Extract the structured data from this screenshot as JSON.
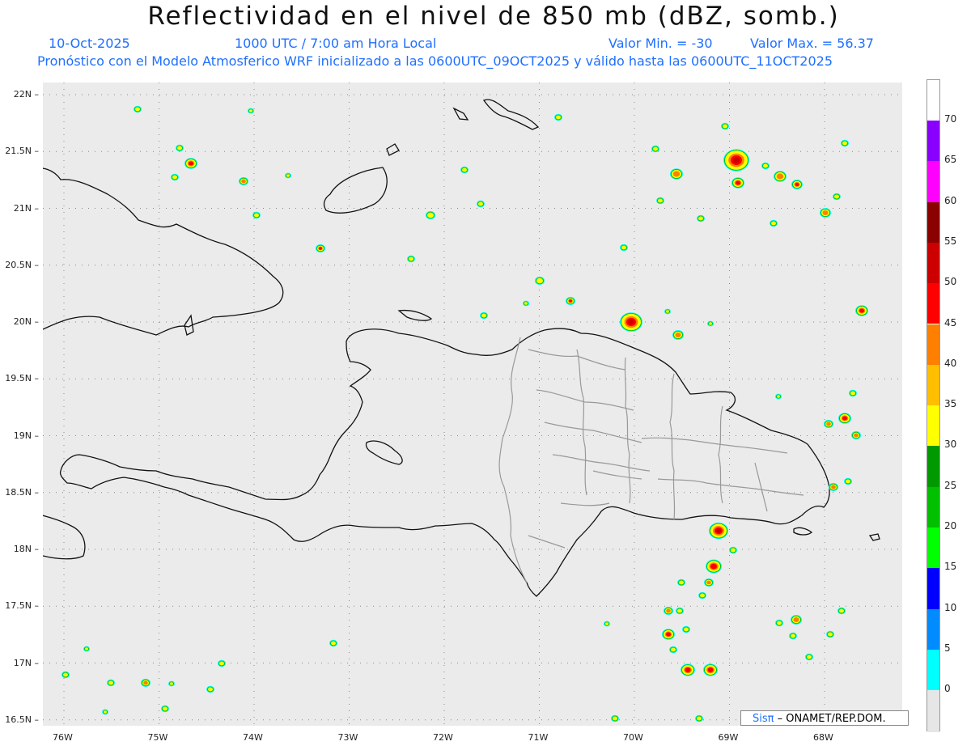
{
  "header": {
    "title": "Reflectividad en el nivel de 850 mb (dBZ, somb.)",
    "date": "10-Oct-2025",
    "time": "1000 UTC / 7:00 am Hora Local",
    "valor_min": "Valor Min. = -30",
    "valor_max": "Valor Max. = 56.37",
    "subtitle": "Pronóstico con el Modelo Atmosferico WRF inicializado a las 0600UTC_09OCT2025 y válido hasta las  0600UTC_11OCT2025"
  },
  "map": {
    "lat_labels": [
      "22N",
      "21.5N",
      "21N",
      "20.5N",
      "20N",
      "19.5N",
      "19N",
      "18.5N",
      "18N",
      "17.5N",
      "17N",
      "16.5N"
    ],
    "lon_labels": [
      "76W",
      "75W",
      "74W",
      "73W",
      "72W",
      "71W",
      "70W",
      "69W",
      "68W"
    ],
    "lat_ticks": [
      22,
      21.5,
      21,
      20.5,
      20,
      19.5,
      19,
      18.5,
      18,
      17.5,
      17,
      16.5
    ],
    "lon_ticks": [
      -76,
      -75,
      -74,
      -73,
      -72,
      -71,
      -70,
      -69,
      -68
    ]
  },
  "colorbar": {
    "labels": [
      "70",
      "65",
      "60",
      "55",
      "50",
      "45",
      "40",
      "35",
      "30",
      "25",
      "20",
      "15",
      "10",
      "5",
      "0"
    ],
    "colors": [
      "#ffffff",
      "#8a00ff",
      "#ff00ff",
      "#8b0000",
      "#cc0000",
      "#ff0000",
      "#ff7f00",
      "#ffbf00",
      "#ffff00",
      "#009900",
      "#00c000",
      "#00ff00",
      "#0000ff",
      "#008cff",
      "#00ffff"
    ]
  },
  "credit": {
    "sis": "Sisπ",
    "text": "– ONAMET/REP.DOM."
  }
}
